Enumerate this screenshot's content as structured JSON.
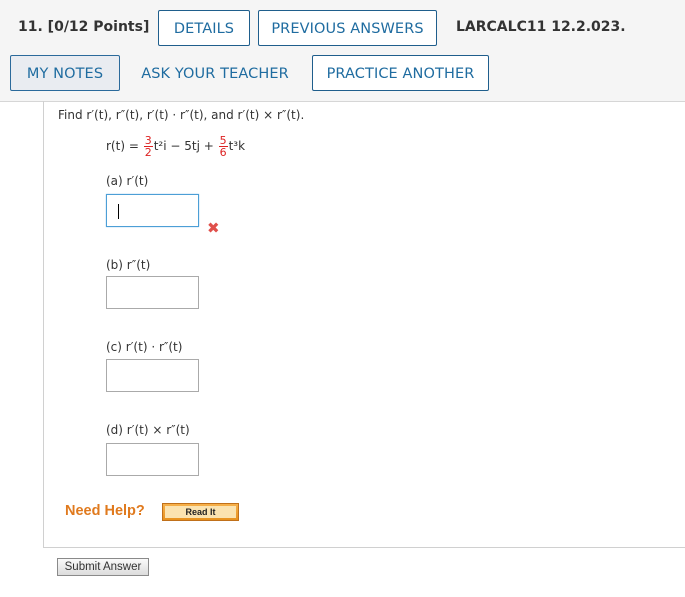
{
  "header": {
    "question_label": "11.  [0/12 Points]",
    "details_label": "DETAILS",
    "previous_answers_label": "PREVIOUS ANSWERS",
    "assignment_id": "LARCALC11 12.2.023.",
    "my_notes_label": "MY NOTES",
    "ask_teacher_label": "ASK YOUR TEACHER",
    "practice_another_label": "PRACTICE ANOTHER"
  },
  "problem": {
    "prompt": "Find r′(t), r″(t), r′(t) · r″(t), and r′(t) × r″(t).",
    "r_label": "r(t) =",
    "frac1_num": "3",
    "frac1_den": "2",
    "term1_rest": "t²i − 5tj + ",
    "frac2_num": "5",
    "frac2_den": "6",
    "term2_rest": "t³k"
  },
  "parts": [
    {
      "label": "(a)   r′(t)",
      "value": "",
      "status": "incorrect"
    },
    {
      "label": "(b)   r″(t)",
      "value": ""
    },
    {
      "label": "(c)   r′(t) · r″(t)",
      "value": ""
    },
    {
      "label": "(d)   r′(t) × r″(t)",
      "value": ""
    }
  ],
  "help": {
    "need_help_label": "Need Help?",
    "read_it_label": "Read It"
  },
  "submit_label": "Submit Answer",
  "colors": {
    "accent": "#1f6ca0",
    "error": "#e0504b",
    "help": "#e07a1e"
  }
}
